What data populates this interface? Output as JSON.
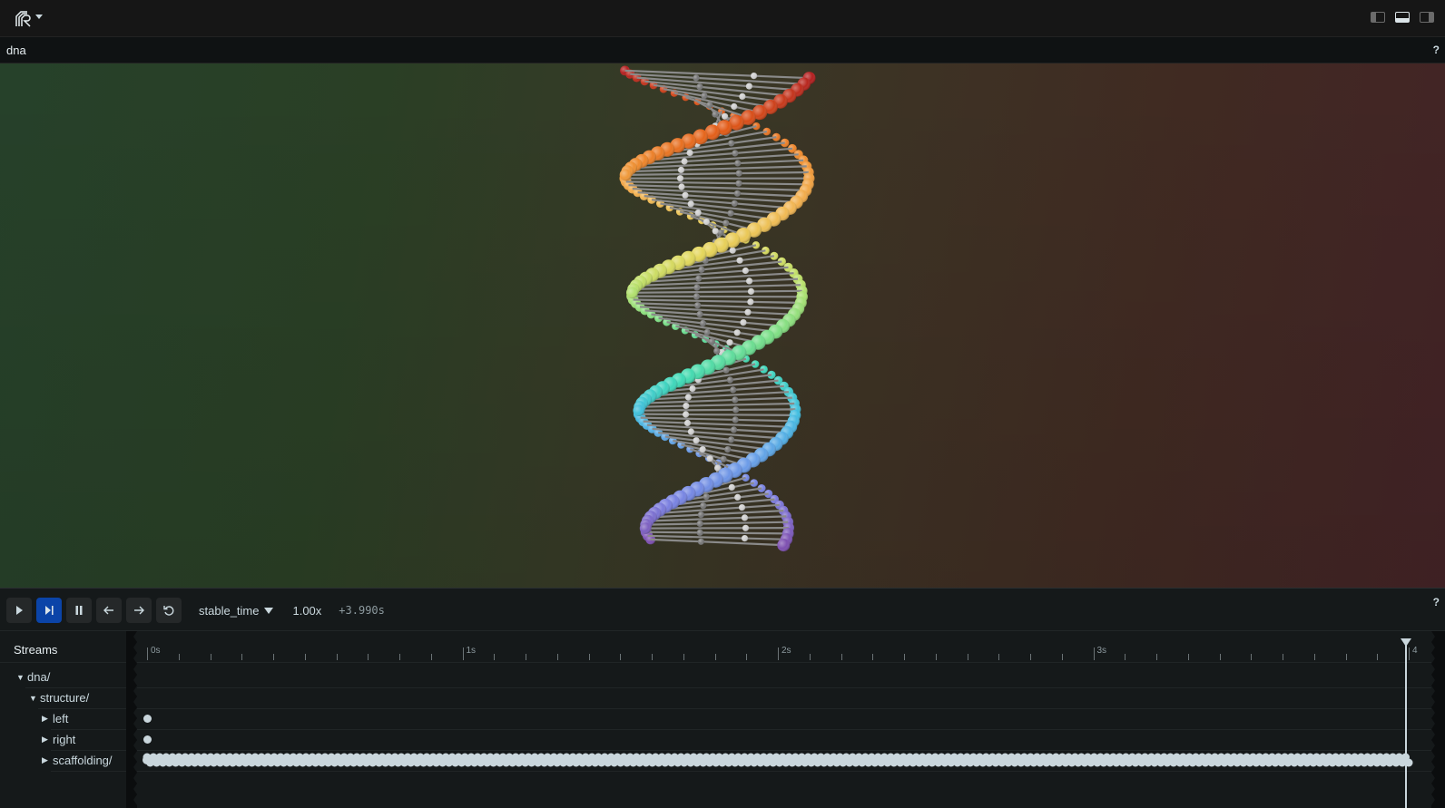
{
  "app": {
    "logo_icon": "rerun-logo-icon",
    "menu_caret_icon": "chevron-down-icon",
    "panel_toggles": [
      {
        "name": "toggle-left-panel",
        "icon": "left-panel-icon",
        "active": false
      },
      {
        "name": "toggle-bottom-panel",
        "icon": "bottom-panel-icon",
        "active": true
      },
      {
        "name": "toggle-right-panel",
        "icon": "right-panel-icon",
        "active": false
      }
    ]
  },
  "viewport": {
    "title": "dna",
    "help_label": "?",
    "scene": {
      "description": "3D double helix of colored points connected by gray scaffolding lines",
      "strand_colors": [
        "#b31f1f",
        "#e25a16",
        "#ee8a2d",
        "#f2b552",
        "#e4d65a",
        "#b8e06a",
        "#78de86",
        "#3ed9b5",
        "#40bde0",
        "#6b9be8",
        "#7a7fe0",
        "#7d4fb0"
      ],
      "scaffold_color": "#8a8a8a",
      "bead_color": "#bfbfbf"
    }
  },
  "time_panel": {
    "controls": [
      {
        "name": "play-button",
        "icon": "play-icon",
        "active": false
      },
      {
        "name": "follow-button",
        "icon": "play-to-end-icon",
        "active": true
      },
      {
        "name": "pause-button",
        "icon": "pause-icon",
        "active": false
      },
      {
        "name": "step-back-button",
        "icon": "arrow-left-icon",
        "active": false
      },
      {
        "name": "step-forward-button",
        "icon": "arrow-right-icon",
        "active": false
      },
      {
        "name": "loop-button",
        "icon": "loop-icon",
        "active": false
      }
    ],
    "timeline_name": "stable_time",
    "speed": "1.00x",
    "time_offset": "+3.990s",
    "help_label": "?",
    "streams_header": "Streams",
    "tree": [
      {
        "label": "dna/",
        "depth": 0,
        "expanded": true
      },
      {
        "label": "structure/",
        "depth": 1,
        "expanded": true
      },
      {
        "label": "left",
        "depth": 2,
        "expanded": false
      },
      {
        "label": "right",
        "depth": 2,
        "expanded": false
      },
      {
        "label": "scaffolding/",
        "depth": 2,
        "expanded": false
      }
    ],
    "ruler": {
      "labels": [
        "0s",
        "1s",
        "2s",
        "3s",
        "4"
      ],
      "range_seconds": [
        0,
        4.0
      ],
      "minor_step_seconds": 0.1
    },
    "current_time_seconds": 3.99,
    "events": {
      "left": [
        0
      ],
      "right": [
        0
      ],
      "scaffolding": {
        "from": 0,
        "to": 3.99
      }
    }
  }
}
